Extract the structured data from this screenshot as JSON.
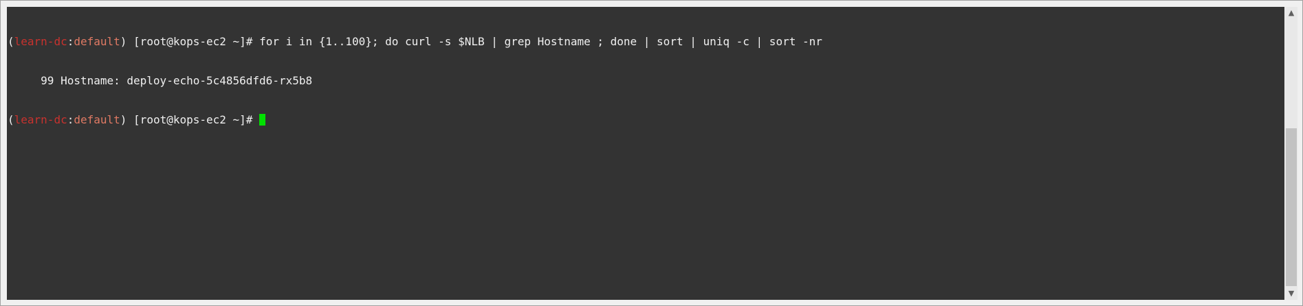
{
  "terminal": {
    "lines": [
      {
        "open_paren": "(",
        "context_name": "learn-dc",
        "context_sep": ":",
        "namespace": "default",
        "prompt_rest": ") [root@kops-ec2 ~]# ",
        "command": "for i in {1..100}; do curl -s $NLB | grep Hostname ; done | sort | uniq -c | sort -nr"
      },
      {
        "output": "     99 Hostname: deploy-echo-5c4856dfd6-rx5b8"
      },
      {
        "open_paren": "(",
        "context_name": "learn-dc",
        "context_sep": ":",
        "namespace": "default",
        "prompt_rest": ") [root@kops-ec2 ~]# ",
        "command": ""
      }
    ]
  },
  "scrollbar": {
    "up_glyph": "▲",
    "down_glyph": "▼"
  },
  "colors": {
    "background": "#333333",
    "foreground": "#f0f0f0",
    "context_name": "#c8322e",
    "namespace": "#e07a64",
    "cursor": "#00e000"
  }
}
